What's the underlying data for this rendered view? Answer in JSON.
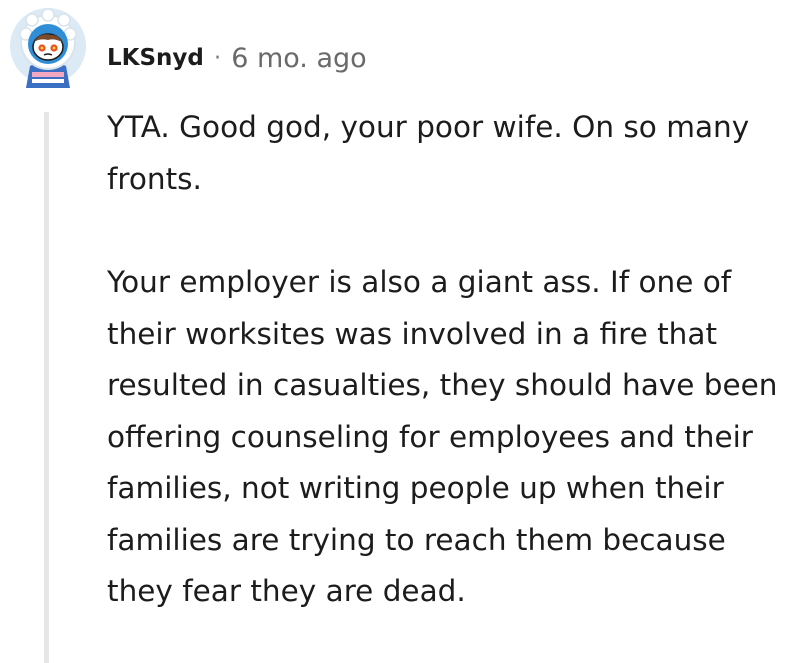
{
  "comment": {
    "username": "LKSnyd",
    "separator": "·",
    "timestamp": "6 mo. ago",
    "avatar_icon": "snoo-avatar-icon",
    "paragraphs": [
      "YTA. Good god, your poor wife. On so many fronts.",
      "Your employer is also a giant ass. If one of their worksites was involved in a fire that resulted in casualties, they should have been offering counseling for employees and their families, not writing people up when their families are trying to reach them because they fear they are dead."
    ]
  },
  "colors": {
    "text": "#1c1c1c",
    "meta": "#6a6a6a",
    "thread_line": "#e6e6e6",
    "avatar_bg": "#dceaf5",
    "avatar_hood": "#2f8ed6",
    "avatar_eyes": "#e8531d"
  }
}
